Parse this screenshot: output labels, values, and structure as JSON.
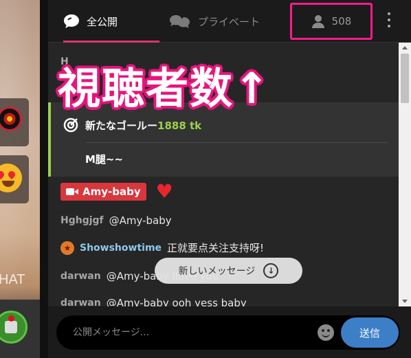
{
  "video": {
    "chat_label": "HAT"
  },
  "tabs": {
    "public": {
      "label": "全公開",
      "icon": "chat-bubble-icon"
    },
    "private": {
      "label": "プライベート",
      "icon": "private-chat-icon"
    },
    "viewers": {
      "count": "508",
      "icon": "user-icon"
    }
  },
  "overlay": {
    "text": "視聴者数↑",
    "color": "#e8147d"
  },
  "messages": {
    "faint_line": "H",
    "goal": {
      "label": "新たなゴールー",
      "amount": "1888 tk",
      "sub": "M腿~~",
      "accent": "#9bd14a"
    },
    "host": {
      "name": "Amy-baby"
    },
    "lines": [
      {
        "user": "Hghgjgf",
        "text": "@Amy-baby"
      },
      {
        "user": "Showshowtime",
        "text": "正就要点关注支持呀!"
      },
      {
        "user": "darwan",
        "text": "@Amy-baby  ilove you"
      },
      {
        "user": "darwan",
        "text": "@Amy-baby  ooh yess baby"
      }
    ]
  },
  "new_messages": {
    "label": "新しいメッセージ"
  },
  "composer": {
    "placeholder": "公開メッセージ...",
    "send_label": "送信"
  }
}
